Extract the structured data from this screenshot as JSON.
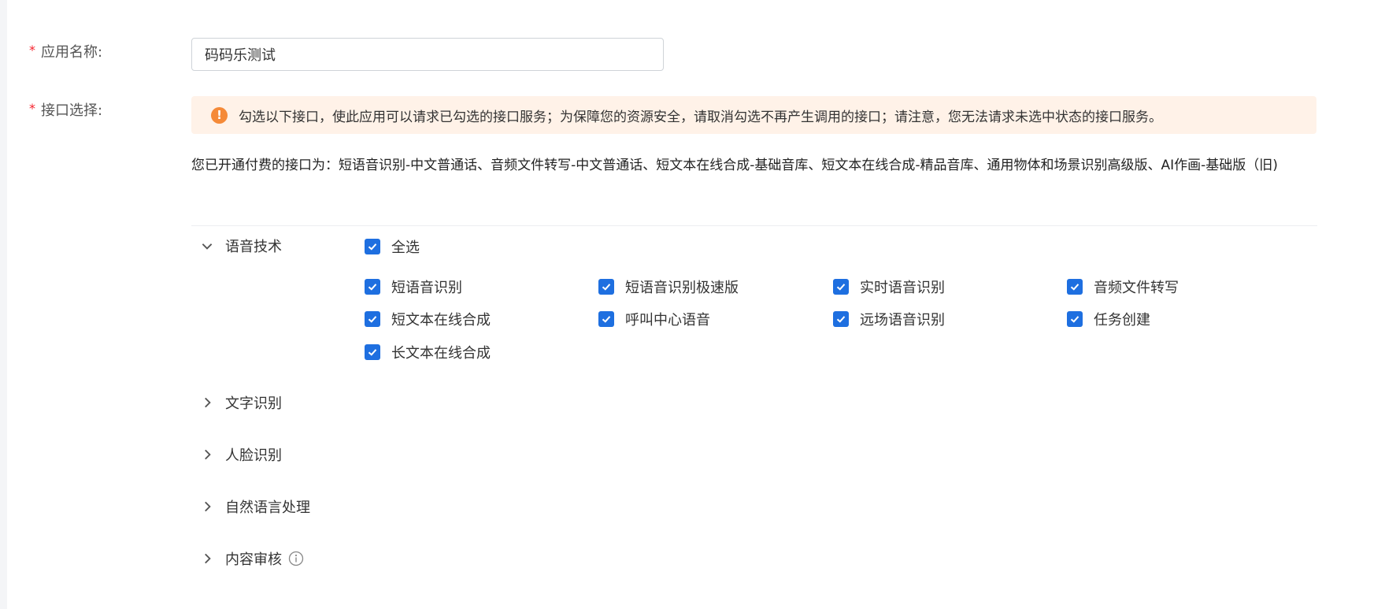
{
  "form": {
    "required_mark": "*",
    "app_name": {
      "label": "应用名称:",
      "value": "码码乐测试"
    },
    "api_select": {
      "label": "接口选择:"
    }
  },
  "alert": {
    "icon": "!",
    "text": "勾选以下接口，使此应用可以请求已勾选的接口服务；为保障您的资源安全，请取消勾选不再产生调用的接口；请注意，您无法请求未选中状态的接口服务。"
  },
  "notice": "您已开通付费的接口为：短语音识别-中文普通话、音频文件转写-中文普通话、短文本在线合成-基础音库、短文本在线合成-精品音库、通用物体和场景识别高级版、AI作画-基础版（旧)",
  "sections": {
    "speech": {
      "title": "语音技术",
      "select_all": "全选",
      "items": [
        "短语音识别",
        "短语音识别极速版",
        "实时语音识别",
        "音频文件转写",
        "短文本在线合成",
        "呼叫中心语音",
        "远场语音识别",
        "任务创建",
        "长文本在线合成"
      ]
    },
    "ocr": {
      "title": "文字识别"
    },
    "face": {
      "title": "人脸识别"
    },
    "nlp": {
      "title": "自然语言处理"
    },
    "audit": {
      "title": "内容审核"
    }
  },
  "icons": {
    "alert": "warning-circle-icon",
    "expand": "chevron-down-icon",
    "collapse": "chevron-right-icon",
    "info": "info-circle-icon",
    "check": "checkmark-icon"
  },
  "colors": {
    "required": "#f5222d",
    "checkbox": "#1e6fe0",
    "alert_bg": "#fff2e8",
    "alert_icon": "#f58a38"
  }
}
